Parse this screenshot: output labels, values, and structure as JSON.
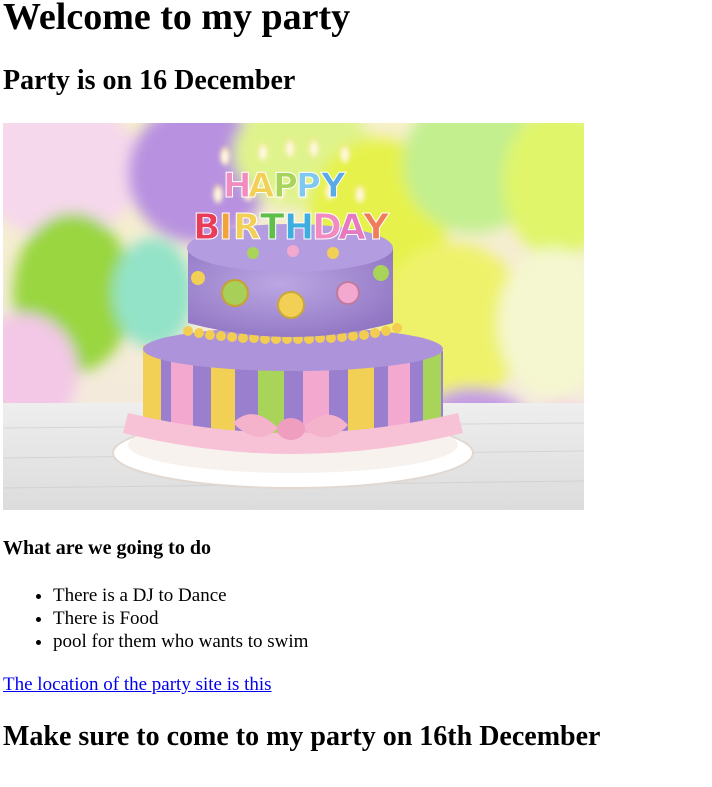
{
  "page": {
    "title": "Welcome to my party",
    "date_heading": "Party is on 16 December",
    "activities_heading": "What are we going to do",
    "activities": [
      "There is a DJ to Dance",
      "There is Food",
      "pool for them who wants to swim"
    ],
    "location_link": "The location of the party site is this",
    "closing_heading": "Make sure to come to my party on 16th December"
  },
  "image": {
    "cake_lettering": [
      "HAPPY",
      "BIRTHDAY"
    ],
    "colors": {
      "cake_purple": "#a58bd0",
      "stripe_pink": "#f3a9cf",
      "stripe_yellow": "#f2cf55",
      "stripe_green": "#a8d45a",
      "ribbon_pink": "#f7c2d6",
      "balloon_yellow": "#e9f24a",
      "balloon_purple": "#b68ddf",
      "balloon_green": "#8fe0b0"
    }
  },
  "links": {
    "color": "#0000ee"
  }
}
